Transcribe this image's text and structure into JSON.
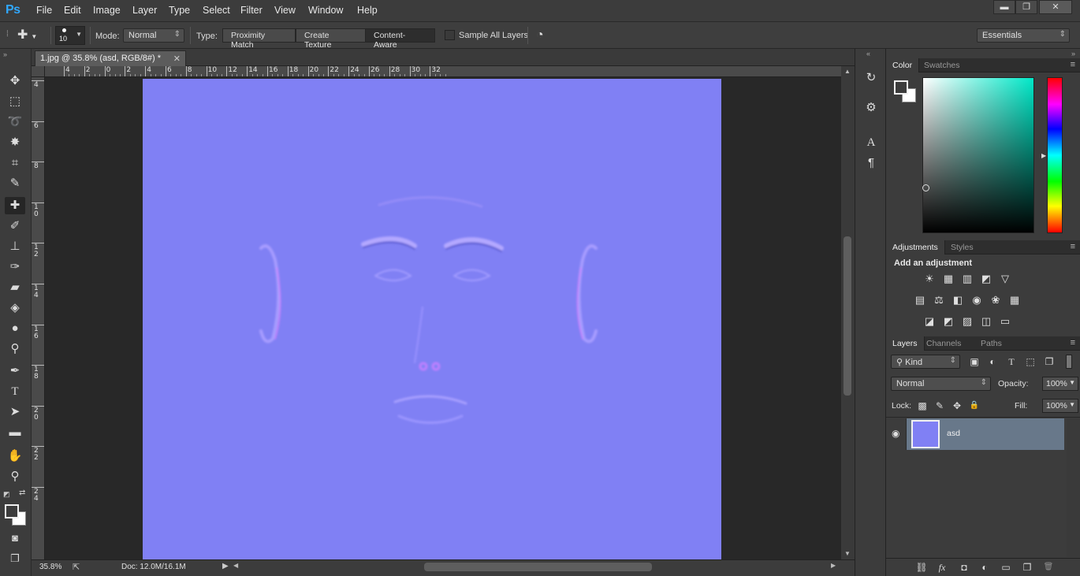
{
  "app": {
    "logo": "Ps"
  },
  "menu": [
    "File",
    "Edit",
    "Image",
    "Layer",
    "Type",
    "Select",
    "Filter",
    "View",
    "Window",
    "Help"
  ],
  "window_controls": {
    "minimize": "▬",
    "restore": "❐",
    "close": "✕"
  },
  "options": {
    "brush_size": "10",
    "mode_label": "Mode:",
    "mode_value": "Normal",
    "type_label": "Type:",
    "type_options": [
      "Proximity Match",
      "Create Texture",
      "Content-Aware"
    ],
    "type_selected": "Content-Aware",
    "sample_all_layers": "Sample All Layers",
    "workspace": "Essentials"
  },
  "document": {
    "tab_title": "1.jpg @ 35.8% (asd, RGB/8#) *",
    "image_color": "#8080f4",
    "ruler_h_labels": [
      "4",
      "2",
      "0",
      "2",
      "4",
      "6",
      "8",
      "10",
      "12",
      "14",
      "16",
      "18",
      "20",
      "22",
      "24",
      "26",
      "28",
      "30",
      "32"
    ],
    "ruler_v_labels": [
      "4",
      "6",
      "8",
      "1 0",
      "1 2",
      "1 4",
      "1 6",
      "1 8",
      "2 0",
      "2 2",
      "2 4"
    ]
  },
  "status": {
    "zoom": "35.8%",
    "doc_size": "Doc: 12.0M/16.1M"
  },
  "tools": [
    {
      "name": "move-tool",
      "glyph": "✥"
    },
    {
      "name": "marquee-tool",
      "glyph": "⬚"
    },
    {
      "name": "lasso-tool",
      "glyph": "➰"
    },
    {
      "name": "magic-wand-tool",
      "glyph": "✸"
    },
    {
      "name": "crop-tool",
      "glyph": "⌗"
    },
    {
      "name": "eyedropper-tool",
      "glyph": "✎"
    },
    {
      "name": "patch-tool",
      "glyph": "✚"
    },
    {
      "name": "brush-tool",
      "glyph": "✐"
    },
    {
      "name": "clone-stamp-tool",
      "glyph": "⊥"
    },
    {
      "name": "history-brush-tool",
      "glyph": "✑"
    },
    {
      "name": "eraser-tool",
      "glyph": "▰"
    },
    {
      "name": "paint-bucket-tool",
      "glyph": "◈"
    },
    {
      "name": "blur-tool",
      "glyph": "●"
    },
    {
      "name": "dodge-tool",
      "glyph": "⚲"
    },
    {
      "name": "pen-tool",
      "glyph": "✒"
    },
    {
      "name": "type-tool",
      "glyph": "T"
    },
    {
      "name": "path-selection-tool",
      "glyph": "➤"
    },
    {
      "name": "rectangle-tool",
      "glyph": "▬"
    },
    {
      "name": "hand-tool",
      "glyph": "✋"
    },
    {
      "name": "zoom-tool",
      "glyph": "⚲"
    }
  ],
  "dock": {
    "history": "↻",
    "properties": "⚙",
    "character": "A",
    "paragraph": "¶"
  },
  "color_panel": {
    "tabs": [
      "Color",
      "Swatches"
    ],
    "fg_color": "#3c3c3c",
    "bg_color": "#ffffff"
  },
  "adjustments_panel": {
    "tabs": [
      "Adjustments",
      "Styles"
    ],
    "heading": "Add an adjustment",
    "rows": [
      [
        "☀",
        "▦",
        "▥",
        "◩",
        "▽"
      ],
      [
        "▤",
        "⚖",
        "◧",
        "◉",
        "❀",
        "▦"
      ],
      [
        "◪",
        "◩",
        "▨",
        "◫",
        "▭"
      ]
    ]
  },
  "layers_panel": {
    "tabs": [
      "Layers",
      "Channels",
      "Paths"
    ],
    "filter_kind": "Kind",
    "filter_icons": [
      "▣",
      "◐",
      "T",
      "⬚",
      "❐"
    ],
    "blend_mode": "Normal",
    "opacity_label": "Opacity:",
    "opacity_value": "100%",
    "lock_label": "Lock:",
    "lock_icons": [
      "▩",
      "✎",
      "✥",
      "🔒"
    ],
    "fill_label": "Fill:",
    "fill_value": "100%",
    "layers": [
      {
        "name": "asd",
        "visible": true
      }
    ],
    "footer_icons": [
      "⛓",
      "fx",
      "◘",
      "◐",
      "▭",
      "❐",
      "🗑"
    ]
  }
}
